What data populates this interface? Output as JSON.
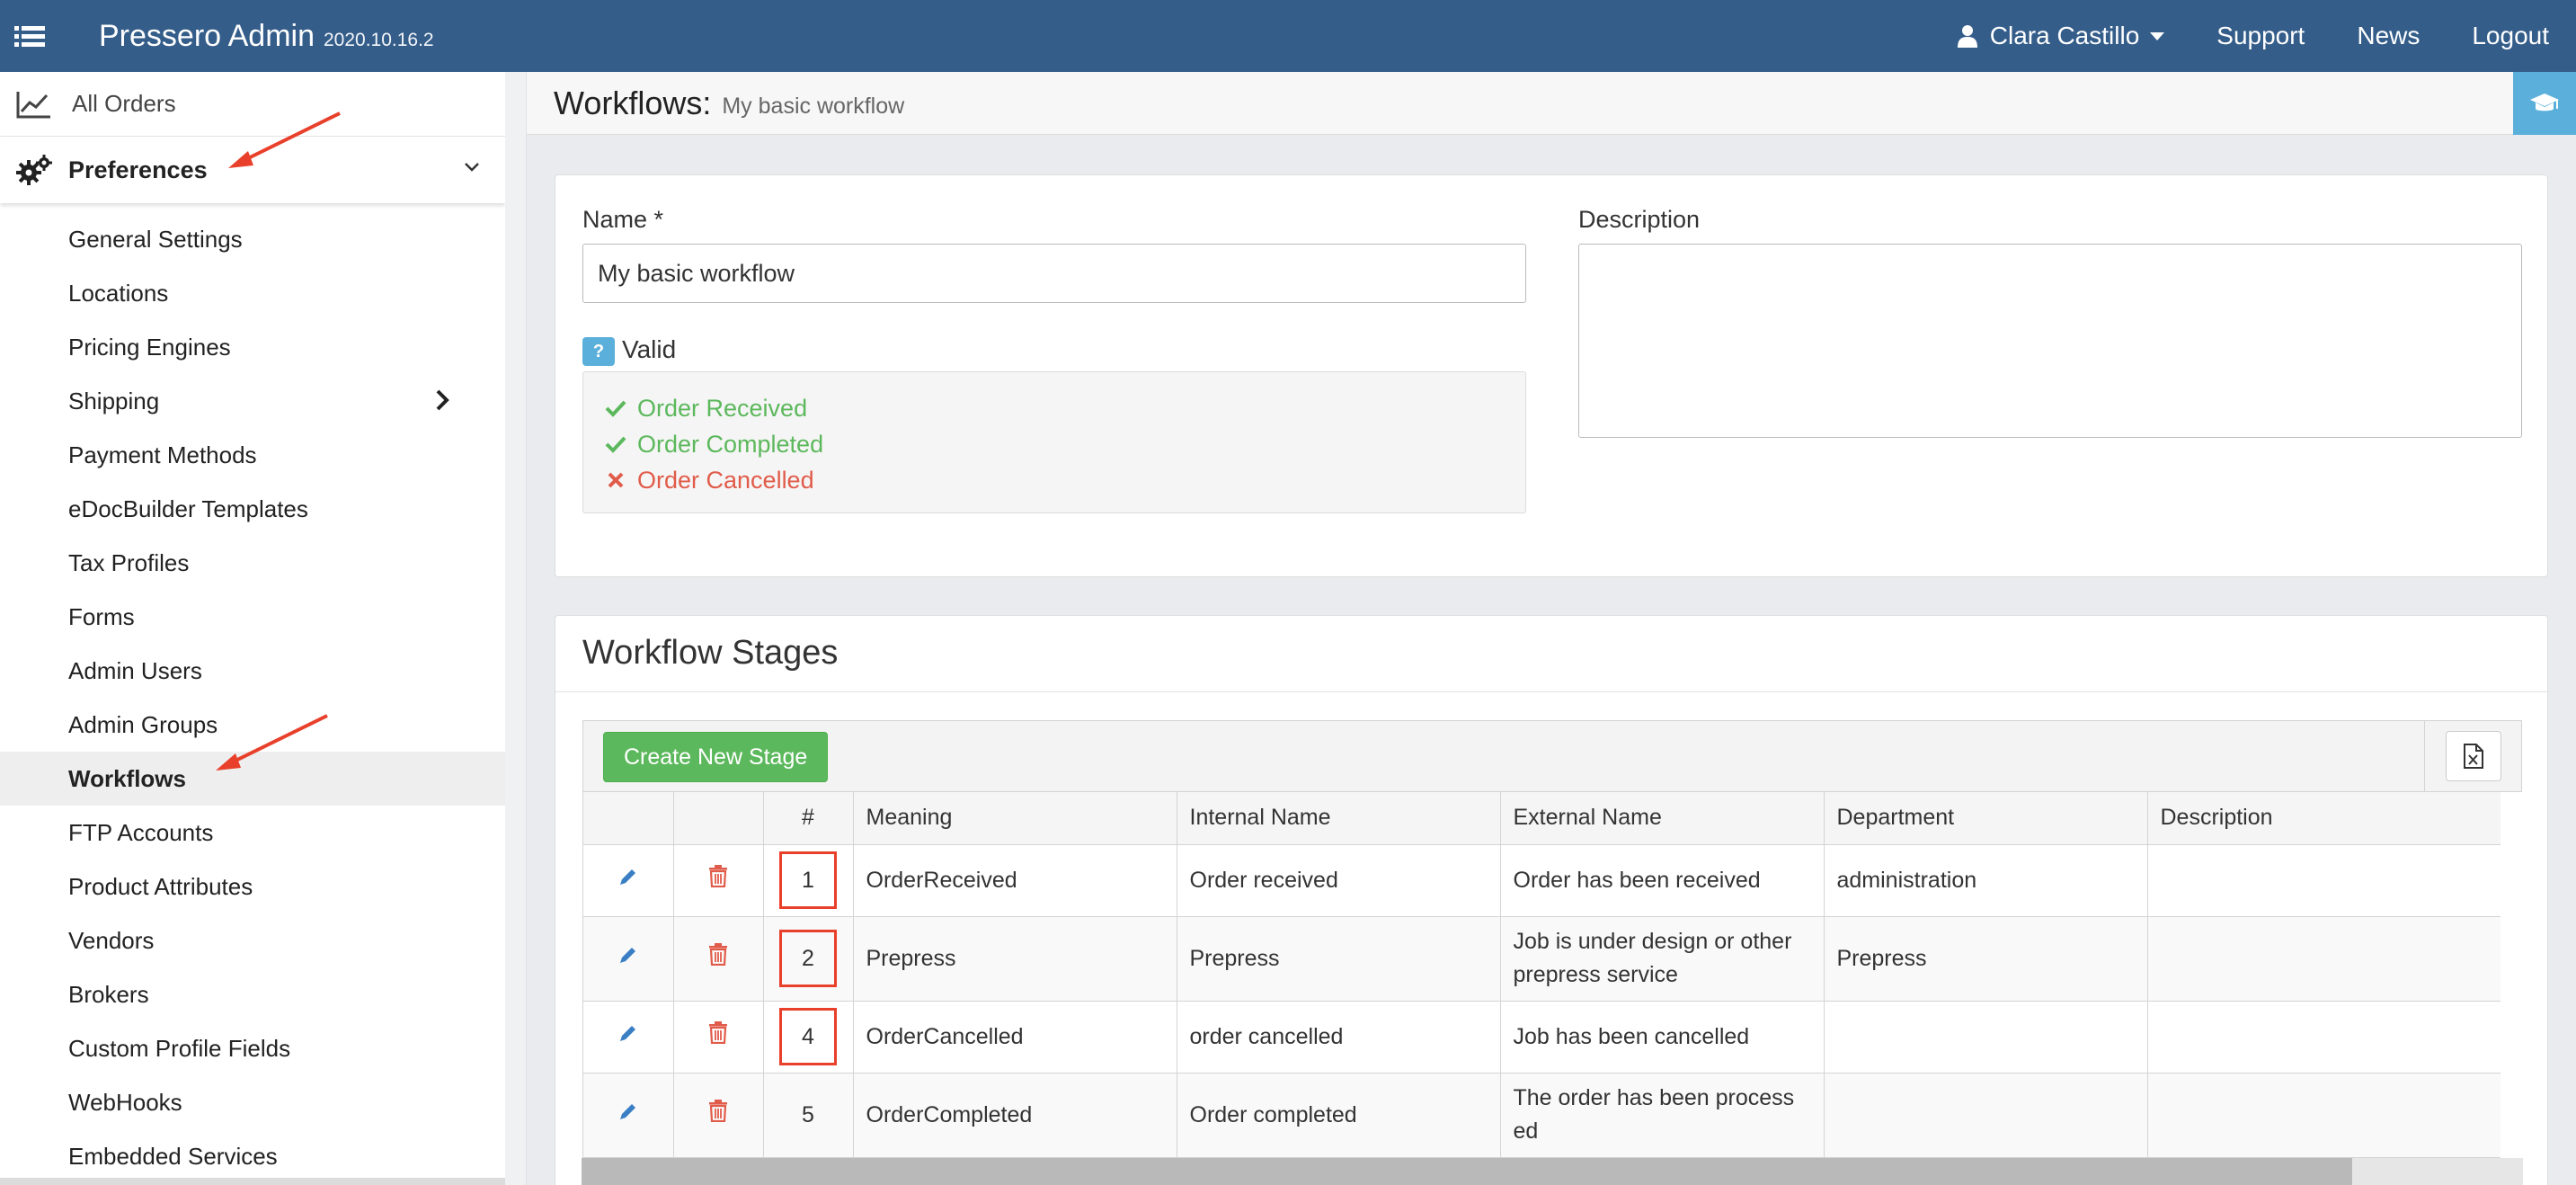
{
  "topbar": {
    "app_name": "Pressero Admin",
    "version": "2020.10.16.2",
    "user_name": "Clara Castillo",
    "support": "Support",
    "news": "News",
    "logout": "Logout"
  },
  "sidebar": {
    "all_orders": "All Orders",
    "preferences": "Preferences",
    "items": [
      "General Settings",
      "Locations",
      "Pricing Engines",
      "Shipping",
      "Payment Methods",
      "eDocBuilder Templates",
      "Tax Profiles",
      "Forms",
      "Admin Users",
      "Admin Groups",
      "Workflows",
      "FTP Accounts",
      "Product Attributes",
      "Vendors",
      "Brokers",
      "Custom Profile Fields",
      "WebHooks",
      "Embedded Services"
    ],
    "active_item": "Workflows"
  },
  "page": {
    "title": "Workflows:",
    "subtitle": "My basic workflow"
  },
  "form": {
    "name_label": "Name *",
    "name_value": "My basic workflow",
    "description_label": "Description",
    "description_value": "",
    "valid_badge": "?",
    "valid_label": "Valid",
    "checks": [
      {
        "label": "Order Received",
        "status": "ok"
      },
      {
        "label": "Order Completed",
        "status": "ok"
      },
      {
        "label": "Order Cancelled",
        "status": "fail"
      }
    ]
  },
  "stages": {
    "title": "Workflow Stages",
    "create_button": "Create New Stage",
    "columns": {
      "num": "#",
      "meaning": "Meaning",
      "internal_name": "Internal Name",
      "external_name": "External Name",
      "department": "Department",
      "description": "Description"
    },
    "rows": [
      {
        "num": "1",
        "meaning": "OrderReceived",
        "internal_name": "Order received",
        "external_name": "Order has been received",
        "department": "administration",
        "description": ""
      },
      {
        "num": "2",
        "meaning": "Prepress",
        "internal_name": "Prepress",
        "external_name": "Job is under design or other prepress service",
        "department": "Prepress",
        "description": ""
      },
      {
        "num": "4",
        "meaning": "OrderCancelled",
        "internal_name": "order cancelled",
        "external_name": "Job has been cancelled",
        "department": "",
        "description": ""
      },
      {
        "num": "5",
        "meaning": "OrderCompleted",
        "internal_name": "Order completed",
        "external_name": "The order has been process ed",
        "department": "",
        "description": ""
      }
    ]
  },
  "colors": {
    "topbar": "#345d8a",
    "accent": "#5bb0db",
    "success": "#5cb85c",
    "danger": "#e15b4a",
    "annotation": "#e8402a"
  }
}
